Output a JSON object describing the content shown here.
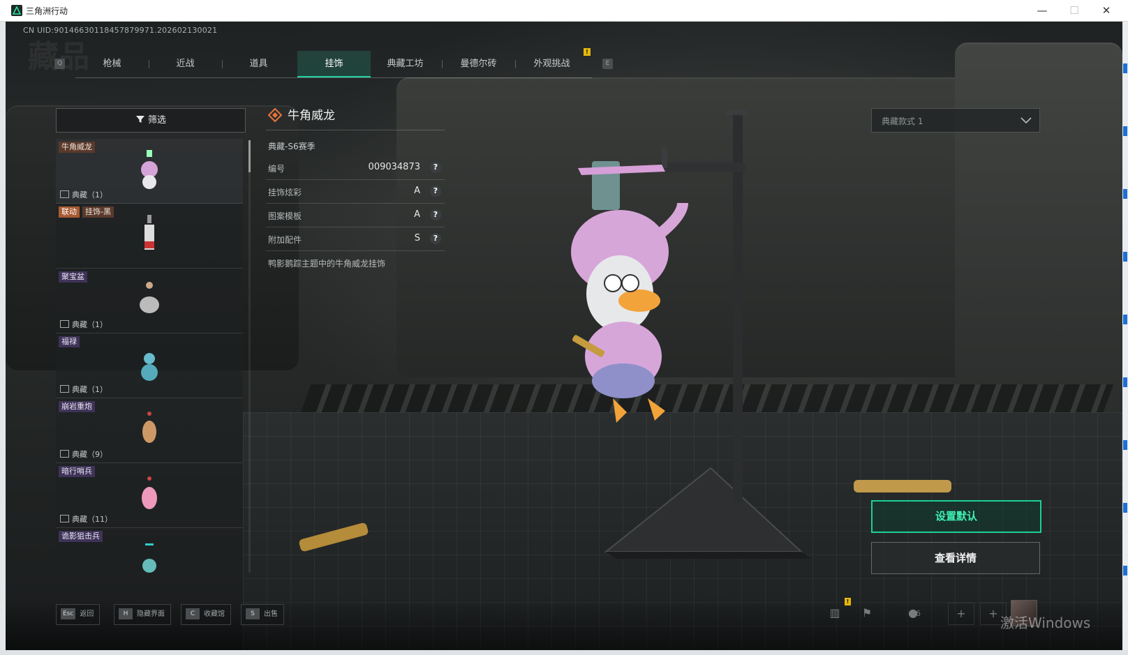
{
  "window": {
    "title": "三角洲行动"
  },
  "uid": "CN UID:9014663011845787997​1.202602130021",
  "tabs": [
    {
      "label": "枪械"
    },
    {
      "label": "近战"
    },
    {
      "label": "道具"
    },
    {
      "label": "挂饰"
    },
    {
      "label": "典藏工坊"
    },
    {
      "label": "曼德尔砖"
    },
    {
      "label": "外观挑战"
    }
  ],
  "tab_keys": {
    "prev": "Q",
    "next": "E"
  },
  "tab_badge": "!",
  "filter": {
    "label": "筛选"
  },
  "list_items": [
    {
      "tag": "牛角威龙",
      "tag2": "",
      "count": "典藏（1）",
      "selected": true
    },
    {
      "tag": "联动",
      "tag2": "挂饰-黑",
      "count": ""
    },
    {
      "tag": "聚宝盆",
      "tag2": "",
      "count": "典藏（1）"
    },
    {
      "tag": "福禄",
      "tag2": "",
      "count": "典藏（1）"
    },
    {
      "tag": "崩岩重炮",
      "tag2": "",
      "count": "典藏（9）"
    },
    {
      "tag": "暗行哨兵",
      "tag2": "",
      "count": "典藏（11）"
    },
    {
      "tag": "诡影狙击兵",
      "tag2": "",
      "count": ""
    }
  ],
  "detail": {
    "title": "牛角威龙",
    "season": "典藏-S6赛季",
    "props": [
      {
        "key": "编号",
        "value": "009034873"
      },
      {
        "key": "挂饰炫彩",
        "value": "A"
      },
      {
        "key": "图案模板",
        "value": "A"
      },
      {
        "key": "附加配件",
        "value": "S"
      }
    ],
    "description": "鸭影鹅踪主题中的牛角威龙挂饰"
  },
  "style_select": {
    "value": "典藏款式 1"
  },
  "actions": {
    "set_default": "设置默认",
    "view_detail": "查看详情"
  },
  "bottom_hints": [
    {
      "key": "Esc",
      "label": "返回"
    },
    {
      "key": "H",
      "label": "隐藏界面"
    },
    {
      "key": "C",
      "label": "收藏馆"
    },
    {
      "key": "S",
      "label": "出售"
    }
  ],
  "system": {
    "friends_count": "6",
    "badge": "!"
  },
  "watermark": "激活Windows",
  "colors": {
    "accent": "#1bd098",
    "tab_active": "#22d3a2",
    "badge": "#e5b80b"
  }
}
